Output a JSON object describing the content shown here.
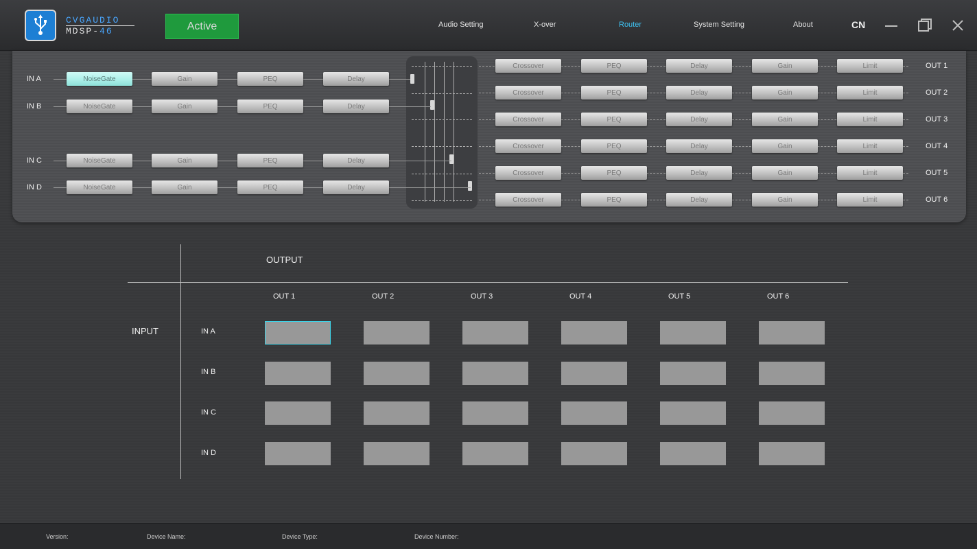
{
  "header": {
    "logo_top": "CVGAUDIO",
    "logo_bottom": "MDSP-",
    "logo_bottom_accent": "46",
    "status_label": "Active",
    "status_color": "#1f9a3d",
    "nav": [
      {
        "label": "Audio Setting",
        "active": false
      },
      {
        "label": "X-over",
        "active": false
      },
      {
        "label": "Router",
        "active": true
      },
      {
        "label": "System Setting",
        "active": false
      },
      {
        "label": "About",
        "active": false
      }
    ],
    "language": "CN",
    "icons": [
      "usb-icon",
      "minimize-icon",
      "maximize-icon",
      "close-icon"
    ]
  },
  "signal_flow": {
    "inputs": [
      "IN A",
      "IN B",
      "IN C",
      "IN D"
    ],
    "input_chain": [
      "NoiseGate",
      "Gain",
      "PEQ",
      "Delay"
    ],
    "selected_module": "NoiseGate",
    "outputs": [
      "OUT 1",
      "OUT 2",
      "OUT 3",
      "OUT 4",
      "OUT 5",
      "OUT 6"
    ],
    "output_chain": [
      "Crossover",
      "PEQ",
      "Delay",
      "Gain",
      "Limit"
    ]
  },
  "matrix": {
    "output_title": "OUTPUT",
    "input_title": "INPUT",
    "columns": [
      "OUT 1",
      "OUT 2",
      "OUT 3",
      "OUT 4",
      "OUT 5",
      "OUT 6"
    ],
    "rows": [
      "IN A",
      "IN B",
      "IN C",
      "IN D"
    ],
    "focused_cell": "IN A / OUT 1",
    "accent_color": "#3fd4e8"
  },
  "footer": {
    "version_label": "Version:",
    "device_name_label": "Device Name:",
    "device_type_label": "Device Type:",
    "device_number_label": "Device Number:"
  }
}
